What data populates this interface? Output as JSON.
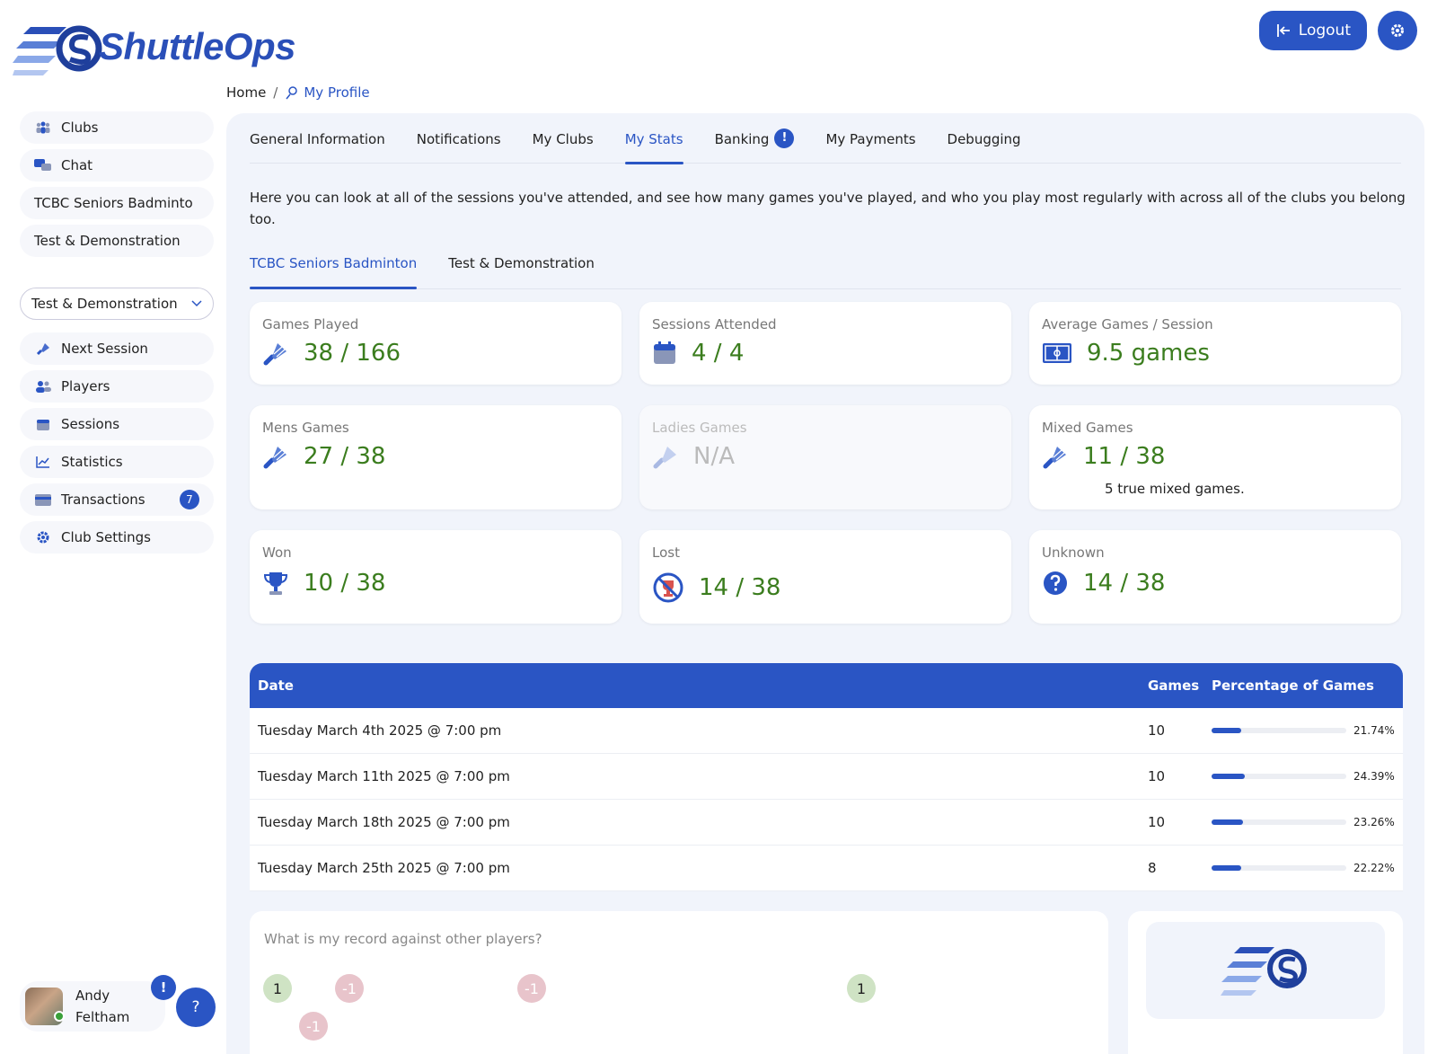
{
  "app": {
    "logo_text": "ShuttleOps"
  },
  "header": {
    "logout_label": "Logout"
  },
  "breadcrumb": {
    "home": "Home",
    "separator": "/",
    "current": "My Profile"
  },
  "sidebar": {
    "top_items": [
      {
        "label": "Clubs",
        "icon": "group-icon"
      },
      {
        "label": "Chat",
        "icon": "chat-icon"
      },
      {
        "label": "TCBC Seniors Badminto"
      },
      {
        "label": "Test & Demonstration"
      }
    ],
    "club_select": {
      "value": "Test & Demonstration"
    },
    "club_items": [
      {
        "label": "Next Session",
        "icon": "shuttlecock-icon"
      },
      {
        "label": "Players",
        "icon": "users-icon"
      },
      {
        "label": "Sessions",
        "icon": "calendar-icon"
      },
      {
        "label": "Statistics",
        "icon": "chart-line-icon"
      },
      {
        "label": "Transactions",
        "icon": "credit-card-icon",
        "badge": "7"
      },
      {
        "label": "Club Settings",
        "icon": "gear-icon"
      }
    ]
  },
  "user": {
    "first_name": "Andy",
    "last_name": "Feltham",
    "alert": "!",
    "help": "?"
  },
  "tabs": [
    {
      "label": "General Information"
    },
    {
      "label": "Notifications"
    },
    {
      "label": "My Clubs"
    },
    {
      "label": "My Stats",
      "active": true
    },
    {
      "label": "Banking",
      "badge": "!"
    },
    {
      "label": "My Payments"
    },
    {
      "label": "Debugging"
    }
  ],
  "intro": "Here you can look at all of the sessions you've attended, and see how many games you've played, and who you play most regularly with across all of the clubs you belong too.",
  "subtabs": [
    {
      "label": "TCBC Seniors Badminton",
      "active": true
    },
    {
      "label": "Test & Demonstration"
    }
  ],
  "stats": {
    "games_played": {
      "label": "Games Played",
      "value": "38 / 166"
    },
    "sessions_attended": {
      "label": "Sessions Attended",
      "value": "4 / 4"
    },
    "average_games": {
      "label": "Average Games / Session",
      "value": "9.5 games"
    },
    "mens_games": {
      "label": "Mens Games",
      "value": "27 / 38"
    },
    "ladies_games": {
      "label": "Ladies Games",
      "value": "N/A"
    },
    "mixed_games": {
      "label": "Mixed Games",
      "value": "11 / 38",
      "note": "5 true mixed games."
    },
    "won": {
      "label": "Won",
      "value": "10 / 38"
    },
    "lost": {
      "label": "Lost",
      "value": "14 / 38"
    },
    "unknown": {
      "label": "Unknown",
      "value": "14 / 38"
    }
  },
  "sessions_table": {
    "headers": {
      "date": "Date",
      "games": "Games",
      "pct": "Percentage of Games"
    },
    "rows": [
      {
        "date": "Tuesday March 4th 2025 @ 7:00 pm",
        "games": "10",
        "pct": "21.74%",
        "fraction": 0.2174
      },
      {
        "date": "Tuesday March 11th 2025 @ 7:00 pm",
        "games": "10",
        "pct": "24.39%",
        "fraction": 0.2439
      },
      {
        "date": "Tuesday March 18th 2025 @ 7:00 pm",
        "games": "10",
        "pct": "23.26%",
        "fraction": 0.2326
      },
      {
        "date": "Tuesday March 25th 2025 @ 7:00 pm",
        "games": "8",
        "pct": "22.22%",
        "fraction": 0.2222
      }
    ]
  },
  "record": {
    "question": "What is my record against other players?",
    "bubbles": [
      "1",
      "-1",
      "-1",
      "1",
      "-1"
    ]
  },
  "colors": {
    "primary": "#2a55c4",
    "value_green": "#3b7d1e",
    "panel_bg": "#f1f4fb"
  }
}
